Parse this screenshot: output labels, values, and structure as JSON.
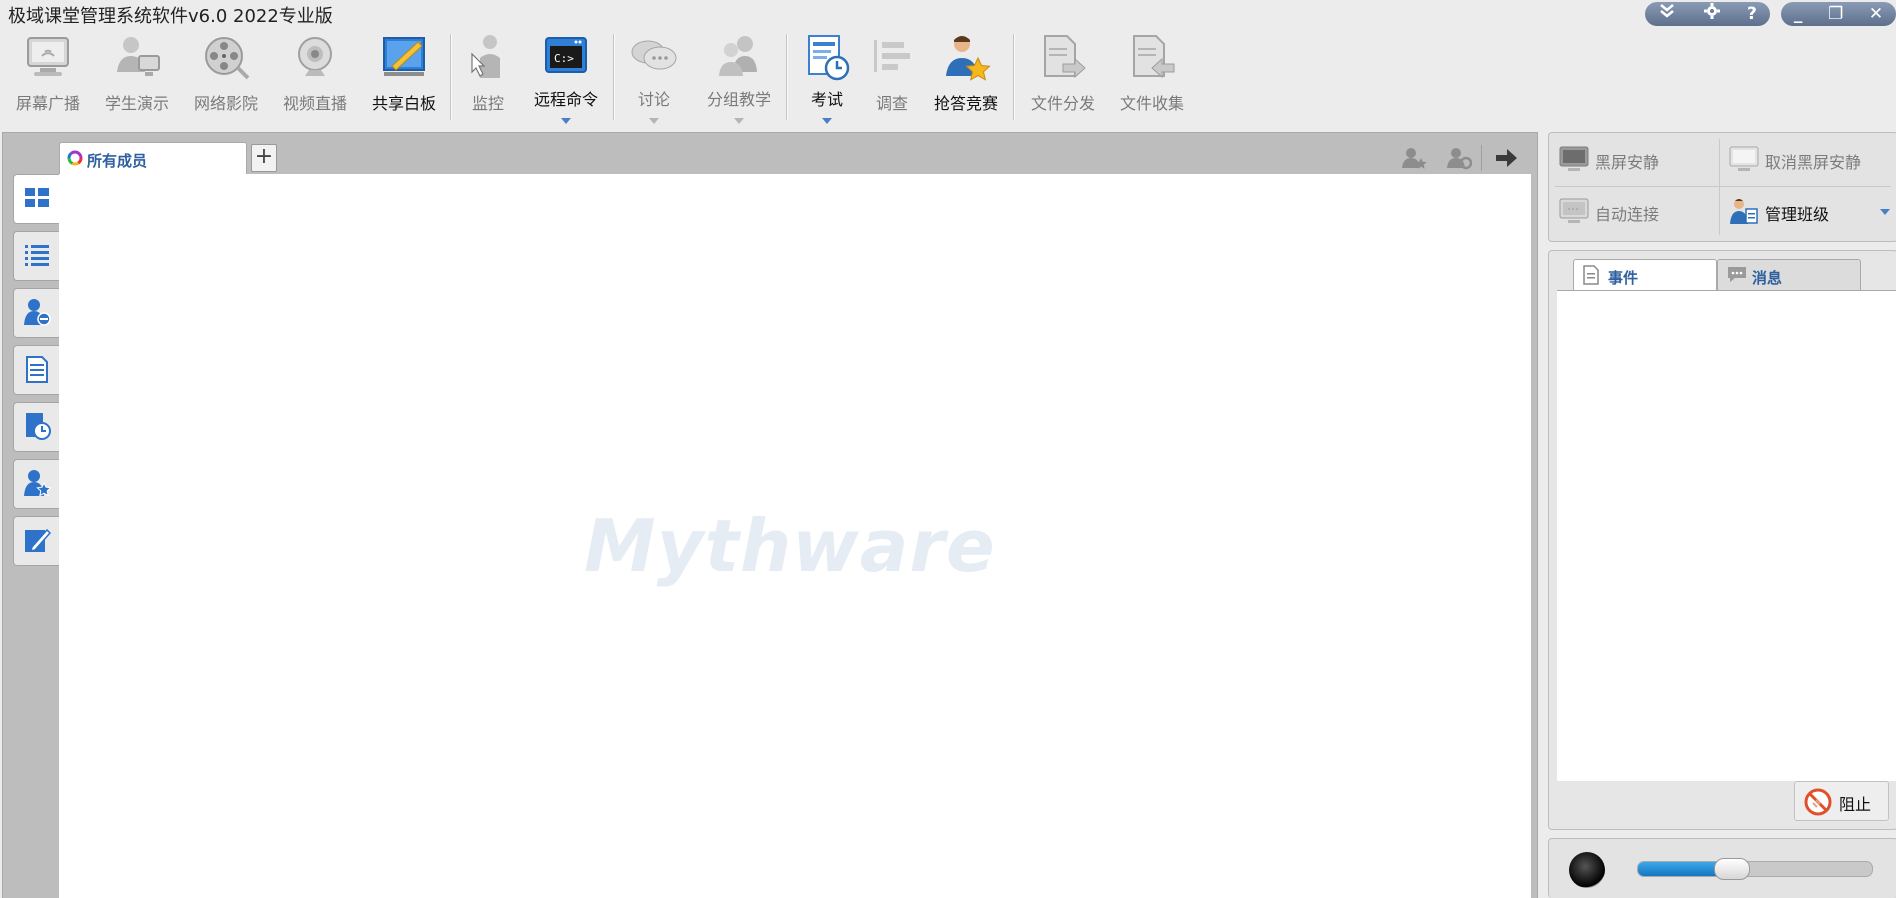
{
  "window": {
    "title": "极域课堂管理系统软件v6.0 2022专业版",
    "controls_left": [
      "chevron-down-double",
      "gear",
      "?"
    ],
    "controls_right": [
      "_",
      "❐",
      "✕"
    ]
  },
  "toolbar": {
    "items": [
      {
        "id": "screen-broadcast",
        "label": "屏幕广播",
        "state": "disabled"
      },
      {
        "id": "student-demo",
        "label": "学生演示",
        "state": "disabled"
      },
      {
        "id": "network-theater",
        "label": "网络影院",
        "state": "disabled"
      },
      {
        "id": "video-live",
        "label": "视频直播",
        "state": "disabled"
      },
      {
        "id": "shared-whiteboard",
        "label": "共享白板",
        "state": "enabled"
      },
      {
        "id": "monitor",
        "label": "监控",
        "state": "disabled"
      },
      {
        "id": "remote-command",
        "label": "远程命令",
        "state": "enabled",
        "dropdown": true
      },
      {
        "id": "discussion",
        "label": "讨论",
        "state": "disabled",
        "dropdown": true
      },
      {
        "id": "group-teaching",
        "label": "分组教学",
        "state": "disabled",
        "dropdown": true
      },
      {
        "id": "exam",
        "label": "考试",
        "state": "enabled",
        "dropdown": true
      },
      {
        "id": "survey",
        "label": "调查",
        "state": "disabled"
      },
      {
        "id": "quiz-contest",
        "label": "抢答竞赛",
        "state": "enabled"
      },
      {
        "id": "file-distribute",
        "label": "文件分发",
        "state": "disabled"
      },
      {
        "id": "file-collect",
        "label": "文件收集",
        "state": "disabled"
      }
    ]
  },
  "main": {
    "tabs": [
      {
        "label": "所有成员",
        "active": true
      }
    ],
    "add_tab_label": "+",
    "header_icons": [
      "user-star-icon",
      "user-gear-icon",
      "arrow-right-icon"
    ],
    "watermark": "Mythware",
    "sidebar": [
      "thumbnail-view",
      "list-view",
      "user-remove",
      "document",
      "document-clock",
      "user-star",
      "edit"
    ]
  },
  "right_panel": {
    "buttons": [
      {
        "label": "黑屏安静",
        "state": "disabled"
      },
      {
        "label": "取消黑屏安静",
        "state": "disabled"
      },
      {
        "label": "自动连接",
        "state": "disabled"
      },
      {
        "label": "管理班级",
        "state": "enabled",
        "dropdown": true
      }
    ],
    "tabs": [
      {
        "label": "事件",
        "active": true
      },
      {
        "label": "消息",
        "active": false
      }
    ],
    "stop_button": "阻止",
    "volume_percent": 40
  },
  "colors": {
    "accent": "#2e5f9e",
    "active_icon": "#3d7fd1",
    "volume": "#1b86d6"
  }
}
